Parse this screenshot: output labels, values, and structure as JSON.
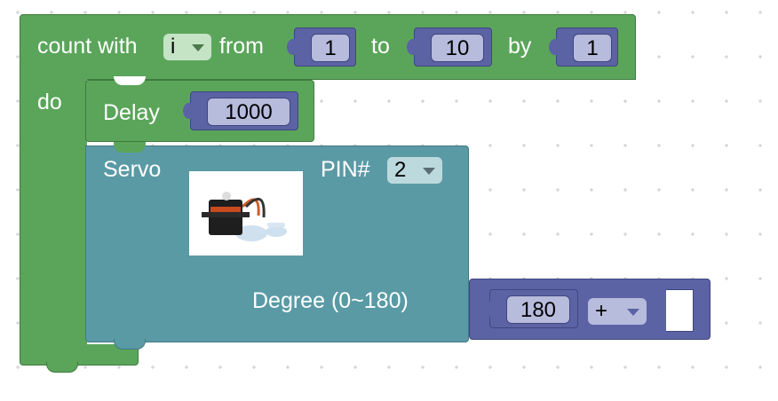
{
  "loop": {
    "label_count": "count with",
    "variable": "i",
    "label_from": "from",
    "from_value": "1",
    "label_to": "to",
    "to_value": "10",
    "label_by": "by",
    "by_value": "1",
    "label_do": "do"
  },
  "delay": {
    "label": "Delay",
    "value": "1000"
  },
  "servo": {
    "label": "Servo",
    "pin_label": "PIN#",
    "pin_value": "2",
    "degree_label": "Degree (0~180)",
    "image_alt": "servo motor"
  },
  "math": {
    "value": "180",
    "operator": "+"
  },
  "colors": {
    "loop_green": "#5ba55b",
    "servo_teal": "#5a9aa5",
    "math_purple": "#5b63a5",
    "field_lavender": "#b7bbdc"
  }
}
